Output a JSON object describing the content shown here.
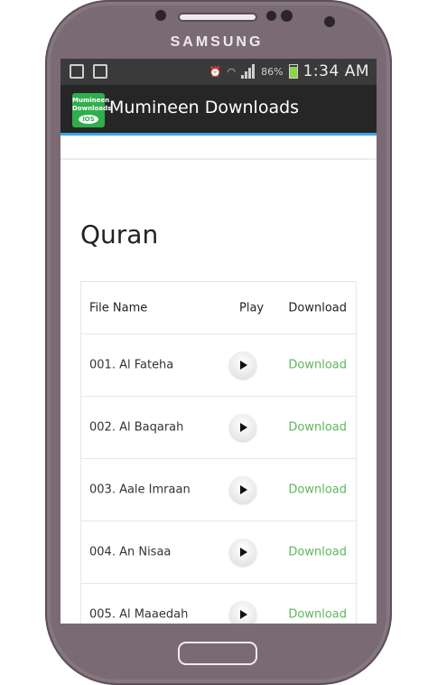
{
  "device": {
    "brand": "SAMSUNG"
  },
  "status_bar": {
    "battery": "86%",
    "time": "1:34 AM",
    "icons": [
      "image-icon",
      "bag-icon",
      "alarm-icon",
      "wifi-icon",
      "signal-icon",
      "battery-icon"
    ]
  },
  "app": {
    "title": "Mumineen Downloads",
    "logo_text": "Mumineen Downloads",
    "logo_badge": "IOS"
  },
  "page": {
    "title": "Quran"
  },
  "table": {
    "headers": {
      "name": "File Name",
      "play": "Play",
      "download": "Download"
    },
    "rows": [
      {
        "name": "001. Al Fateha",
        "download": "Download"
      },
      {
        "name": "002. Al Baqarah",
        "download": "Download"
      },
      {
        "name": "003. Aale Imraan",
        "download": "Download"
      },
      {
        "name": "004. An Nisaa",
        "download": "Download"
      },
      {
        "name": "005. Al Maaedah",
        "download": "Download"
      }
    ]
  },
  "colors": {
    "phone_body": "#7a6a73",
    "action_bar": "#262626",
    "accent_line": "#39a9e8",
    "download_link": "#5cb85c"
  }
}
